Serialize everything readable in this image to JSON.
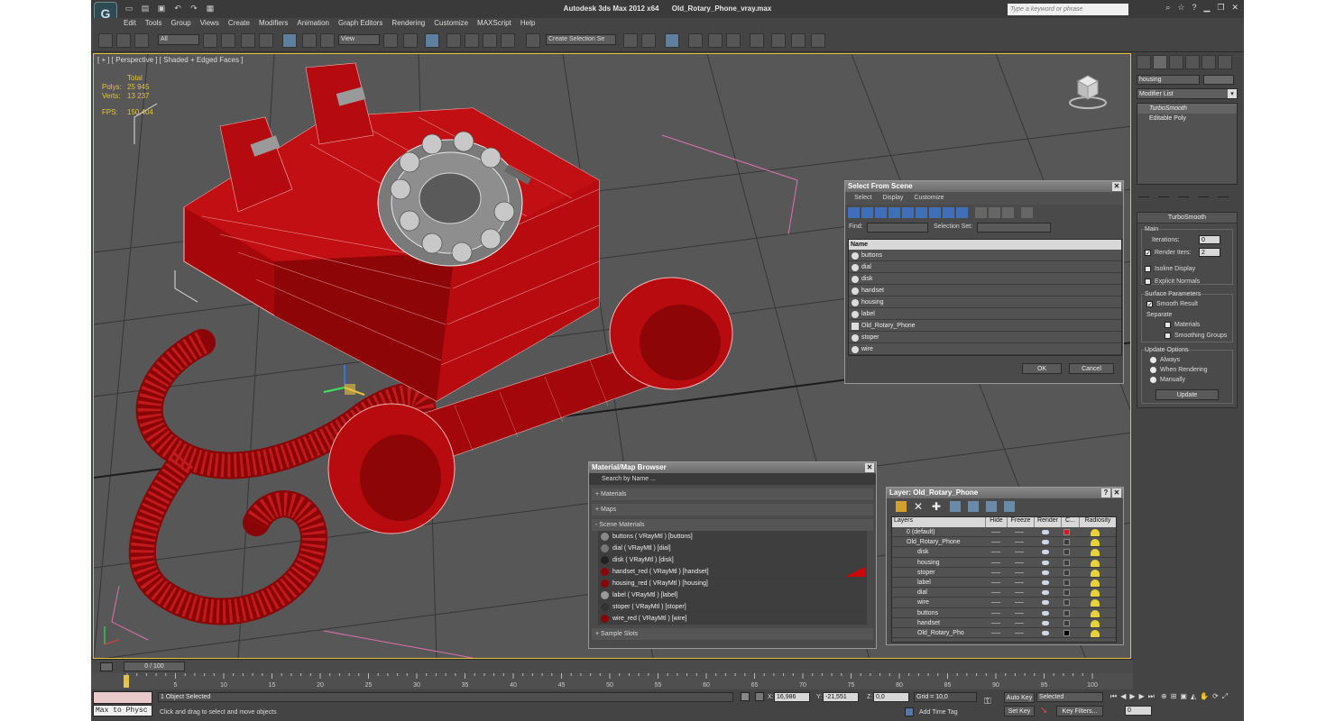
{
  "app": {
    "title_app": "Autodesk 3ds Max  2012 x64",
    "title_file": "Old_Rotary_Phone_vray.max",
    "logo_glyph": "G",
    "search_placeholder": "Type a keyword or phrase"
  },
  "menu": [
    "Edit",
    "Tools",
    "Group",
    "Views",
    "Create",
    "Modifiers",
    "Animation",
    "Graph Editors",
    "Rendering",
    "Customize",
    "MAXScript",
    "Help"
  ],
  "toolbar": {
    "filter_value": "All",
    "refcoord_value": "View",
    "selection_set_placeholder": "Create Selection Se"
  },
  "viewport": {
    "label": "[ + ] [ Perspective ] [ Shaded + Edged Faces ]",
    "stats_header": "Total",
    "polys_label": "Polys:",
    "polys_value": "25 945",
    "verts_label": "Verts:",
    "verts_value": "13 237",
    "fps_label": "FPS:",
    "fps_value": "150,404"
  },
  "select_from_scene": {
    "title": "Select From Scene",
    "menu": [
      "Select",
      "Display",
      "Customize"
    ],
    "find_label": "Find:",
    "selection_set_label": "Selection Set:",
    "column_name": "Name",
    "items": [
      "buttons",
      "dial",
      "disk",
      "handset",
      "housing",
      "label",
      "Old_Rotary_Phone",
      "stoper",
      "wire"
    ],
    "ok_label": "OK",
    "cancel_label": "Cancel"
  },
  "material_browser": {
    "title": "Material/Map Browser",
    "search_placeholder": "Search by Name ...",
    "materials_label": "+ Materials",
    "maps_label": "+ Maps",
    "scene_materials_label": "- Scene Materials",
    "items": [
      "buttons  ( VRayMtl ) [buttons]",
      "dial  ( VRayMtl ) [dial]",
      "disk  ( VRayMtl ) [disk]",
      "handset_red  ( VRayMtl ) [handset]",
      "housing_red  ( VRayMtl ) [housing]",
      "label  ( VRayMtl ) [label]",
      "stoper  ( VRayMtl ) [stoper]",
      "wire_red  ( VRayMtl ) [wire]"
    ],
    "sample_slots_label": "+ Sample Slots"
  },
  "layer_manager": {
    "title": "Layer: Old_Rotary_Phone",
    "help_label": "?",
    "columns": [
      "Layers",
      "Hide",
      "Freeze",
      "Render",
      "C...",
      "Radiosity"
    ],
    "layers": [
      {
        "name": "0 (default)",
        "indent": 0,
        "color": "#c81e1e"
      },
      {
        "name": "Old_Rotary_Phone",
        "indent": 0,
        "color": "#3a3a3a"
      },
      {
        "name": "disk",
        "indent": 1,
        "color": "#3a3a3a"
      },
      {
        "name": "housing",
        "indent": 1,
        "color": "#3a3a3a"
      },
      {
        "name": "stoper",
        "indent": 1,
        "color": "#3a3a3a"
      },
      {
        "name": "label",
        "indent": 1,
        "color": "#3a3a3a"
      },
      {
        "name": "dial",
        "indent": 1,
        "color": "#3a3a3a"
      },
      {
        "name": "wire",
        "indent": 1,
        "color": "#3a3a3a"
      },
      {
        "name": "buttons",
        "indent": 1,
        "color": "#3a3a3a"
      },
      {
        "name": "handset",
        "indent": 1,
        "color": "#3a3a3a"
      },
      {
        "name": "Old_Rotary_Pho",
        "indent": 1,
        "color": "#000000"
      }
    ]
  },
  "command_panel": {
    "object_name": "housing",
    "modifier_list_label": "Modifier List",
    "stack": [
      "TurboSmooth",
      "Editable Poly"
    ],
    "turbosmooth": {
      "title": "TurboSmooth",
      "main_label": "Main",
      "iterations_label": "Iterations:",
      "iterations_value": "0",
      "render_iters_label": "Render Iters:",
      "render_iters_value": "2",
      "isoline_label": "Isoline Display",
      "explicit_normals_label": "Explicit Normals",
      "surface_params_label": "Surface Parameters",
      "smooth_result_label": "Smooth Result",
      "separate_label": "Separate",
      "materials_label": "Materials",
      "smoothing_groups_label": "Smoothing Groups",
      "update_options_label": "Update Options",
      "always_label": "Always",
      "when_rendering_label": "When Rendering",
      "manually_label": "Manually",
      "update_button": "Update"
    }
  },
  "timeline": {
    "slider_label": "0 / 100",
    "ticks": [
      "0",
      "5",
      "10",
      "15",
      "20",
      "25",
      "30",
      "35",
      "40",
      "45",
      "50",
      "55",
      "60",
      "65",
      "70",
      "75",
      "80",
      "85",
      "90",
      "95",
      "100"
    ]
  },
  "status": {
    "listener_text": "Max to Physc",
    "objects_selected": "1 Object Selected",
    "prompt": "Click and drag to select and move objects",
    "x_label": "X:",
    "x_value": "16,986",
    "y_label": "Y:",
    "y_value": "-21,551",
    "z_label": "Z:",
    "z_value": "0,0",
    "grid_label": "Grid = 10,0",
    "add_time_tag": "Add Time Tag",
    "auto_key": "Auto Key",
    "set_key": "Set Key",
    "selected_value": "Selected",
    "key_filters": "Key Filters...",
    "frame_value": "0"
  },
  "colors": {
    "phone_red": "#b0080c",
    "viewport_bg": "#575757",
    "active_border": "#e5c238"
  }
}
